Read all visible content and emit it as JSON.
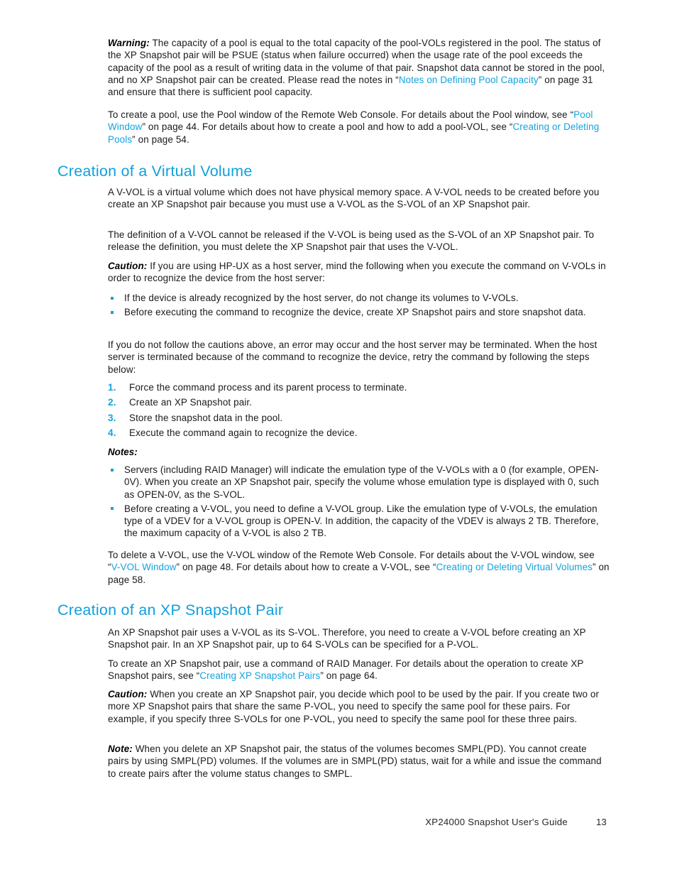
{
  "document": {
    "footer_title": "XP24000 Snapshot User's Guide",
    "page_number": "13"
  },
  "colors": {
    "accent": "#12a2dd",
    "heading": "#10a0dc",
    "body_text": "#1a1a1a"
  },
  "blocks": {
    "warning": {
      "lead": "Warning:",
      "text_1": " The capacity of a pool is equal to the total capacity of the pool-VOLs registered in the pool. The status of the XP Snapshot pair will be PSUE (status when failure occurred) when the usage rate of the pool exceeds the capacity of the pool as a result of writing data in the volume of that pair.  Snapshot data cannot be stored in the pool, and no XP Snapshot pair can be created.  Please read the notes in “",
      "link_1": "Notes on Defining Pool Capacity",
      "text_2": "” on page 31 and ensure that there is sufficient pool capacity."
    },
    "pool_paragraph": {
      "text_1": "To create a pool, use the Pool window of the Remote Web Console.  For details about the Pool window, see “",
      "link_1": "Pool Window",
      "text_2": "” on page 44.  For details about how to create a pool and how to add a pool-VOL, see “",
      "link_2": "Creating or Deleting Pools",
      "text_3": "” on page 54."
    },
    "heading_vvol": "Creation of a Virtual Volume",
    "vvol_intro": "A V-VOL is a virtual volume which does not have physical memory space.  A V-VOL needs to be created before you create an XP Snapshot pair because you must use a V-VOL as the S-VOL of an XP Snapshot pair.",
    "vvol_definition": "The definition of a V-VOL cannot be released if the V-VOL is being used as the S-VOL of an XP Snapshot pair.  To release the definition, you must delete the XP Snapshot pair that uses the V-VOL.",
    "caution_hpux": {
      "lead": "Caution:",
      "text": " If you are using HP-UX as a host server, mind the following when you execute the command on V-VOLs in order to recognize the device from the host server:"
    },
    "hpux_bullets": [
      "If the device is already recognized by the host server, do not change its volumes to V-VOLs.",
      "Before executing the command to recognize the device, create XP Snapshot pairs and store snapshot data."
    ],
    "cautions_followup": "If you do not follow the cautions above, an error may occur and the host server may be terminated.  When the host server is terminated because of the command to recognize the device, retry the command by following the steps below:",
    "steps": [
      {
        "num": "1.",
        "text": "Force the command process and its parent process to terminate."
      },
      {
        "num": "2.",
        "text": "Create an XP Snapshot pair."
      },
      {
        "num": "3.",
        "text": "Store the snapshot data in the pool."
      },
      {
        "num": "4.",
        "text": "Execute the command again to recognize the device."
      }
    ],
    "notes_label": "Notes:",
    "notes_bullets": [
      "Servers (including RAID Manager) will indicate the emulation type of the V-VOLs with a 0 (for example, OPEN-0V). When you create an XP Snapshot pair, specify the volume whose emulation type is displayed with 0, such as OPEN-0V, as the S-VOL.",
      "Before creating a V-VOL, you need to define a V-VOL group.  Like the emulation type of V-VOLs, the emulation type of a VDEV for a V-VOL group is OPEN-V. In addition, the capacity of the VDEV is always 2 TB. Therefore, the maximum capacity of a V-VOL is also 2 TB."
    ],
    "delete_vvol": {
      "text_1": "To delete a V-VOL, use the V-VOL window of the Remote Web Console.  For details about the V-VOL window, see “",
      "link_1": "V-VOL Window",
      "text_2": "” on page 48.  For details about how to create a V-VOL, see “",
      "link_2": "Creating or Deleting Virtual Volumes",
      "text_3": "” on page 58."
    },
    "heading_pair": "Creation of an XP Snapshot Pair",
    "pair_intro": "An XP Snapshot pair uses a V-VOL as its S-VOL. Therefore, you need to create a V-VOL before creating an XP Snapshot pair.  In an XP Snapshot pair, up to 64 S-VOLs can be specified for a P-VOL.",
    "pair_create": {
      "text_1": "To create an XP Snapshot pair, use a command of RAID Manager.  For details about the operation to create XP Snapshot pairs, see “",
      "link_1": "Creating XP Snapshot Pairs",
      "text_2": "” on page 64."
    },
    "caution_pool": {
      "lead": "Caution:",
      "text": " When you create an XP Snapshot pair, you decide which pool to be used by the pair.  If you create two or more XP Snapshot pairs that share the same P-VOL, you need to specify the same pool for these pairs.  For example, if you specify three S-VOLs for one P-VOL, you need to specify the same pool for these three pairs."
    },
    "note_smpl": {
      "lead": "Note:",
      "text": " When you delete an XP Snapshot pair, the status of the volumes becomes SMPL(PD). You cannot create pairs by using SMPL(PD) volumes.  If the volumes are in SMPL(PD) status, wait for a while and issue the command to create pairs after the volume status changes to SMPL."
    }
  }
}
